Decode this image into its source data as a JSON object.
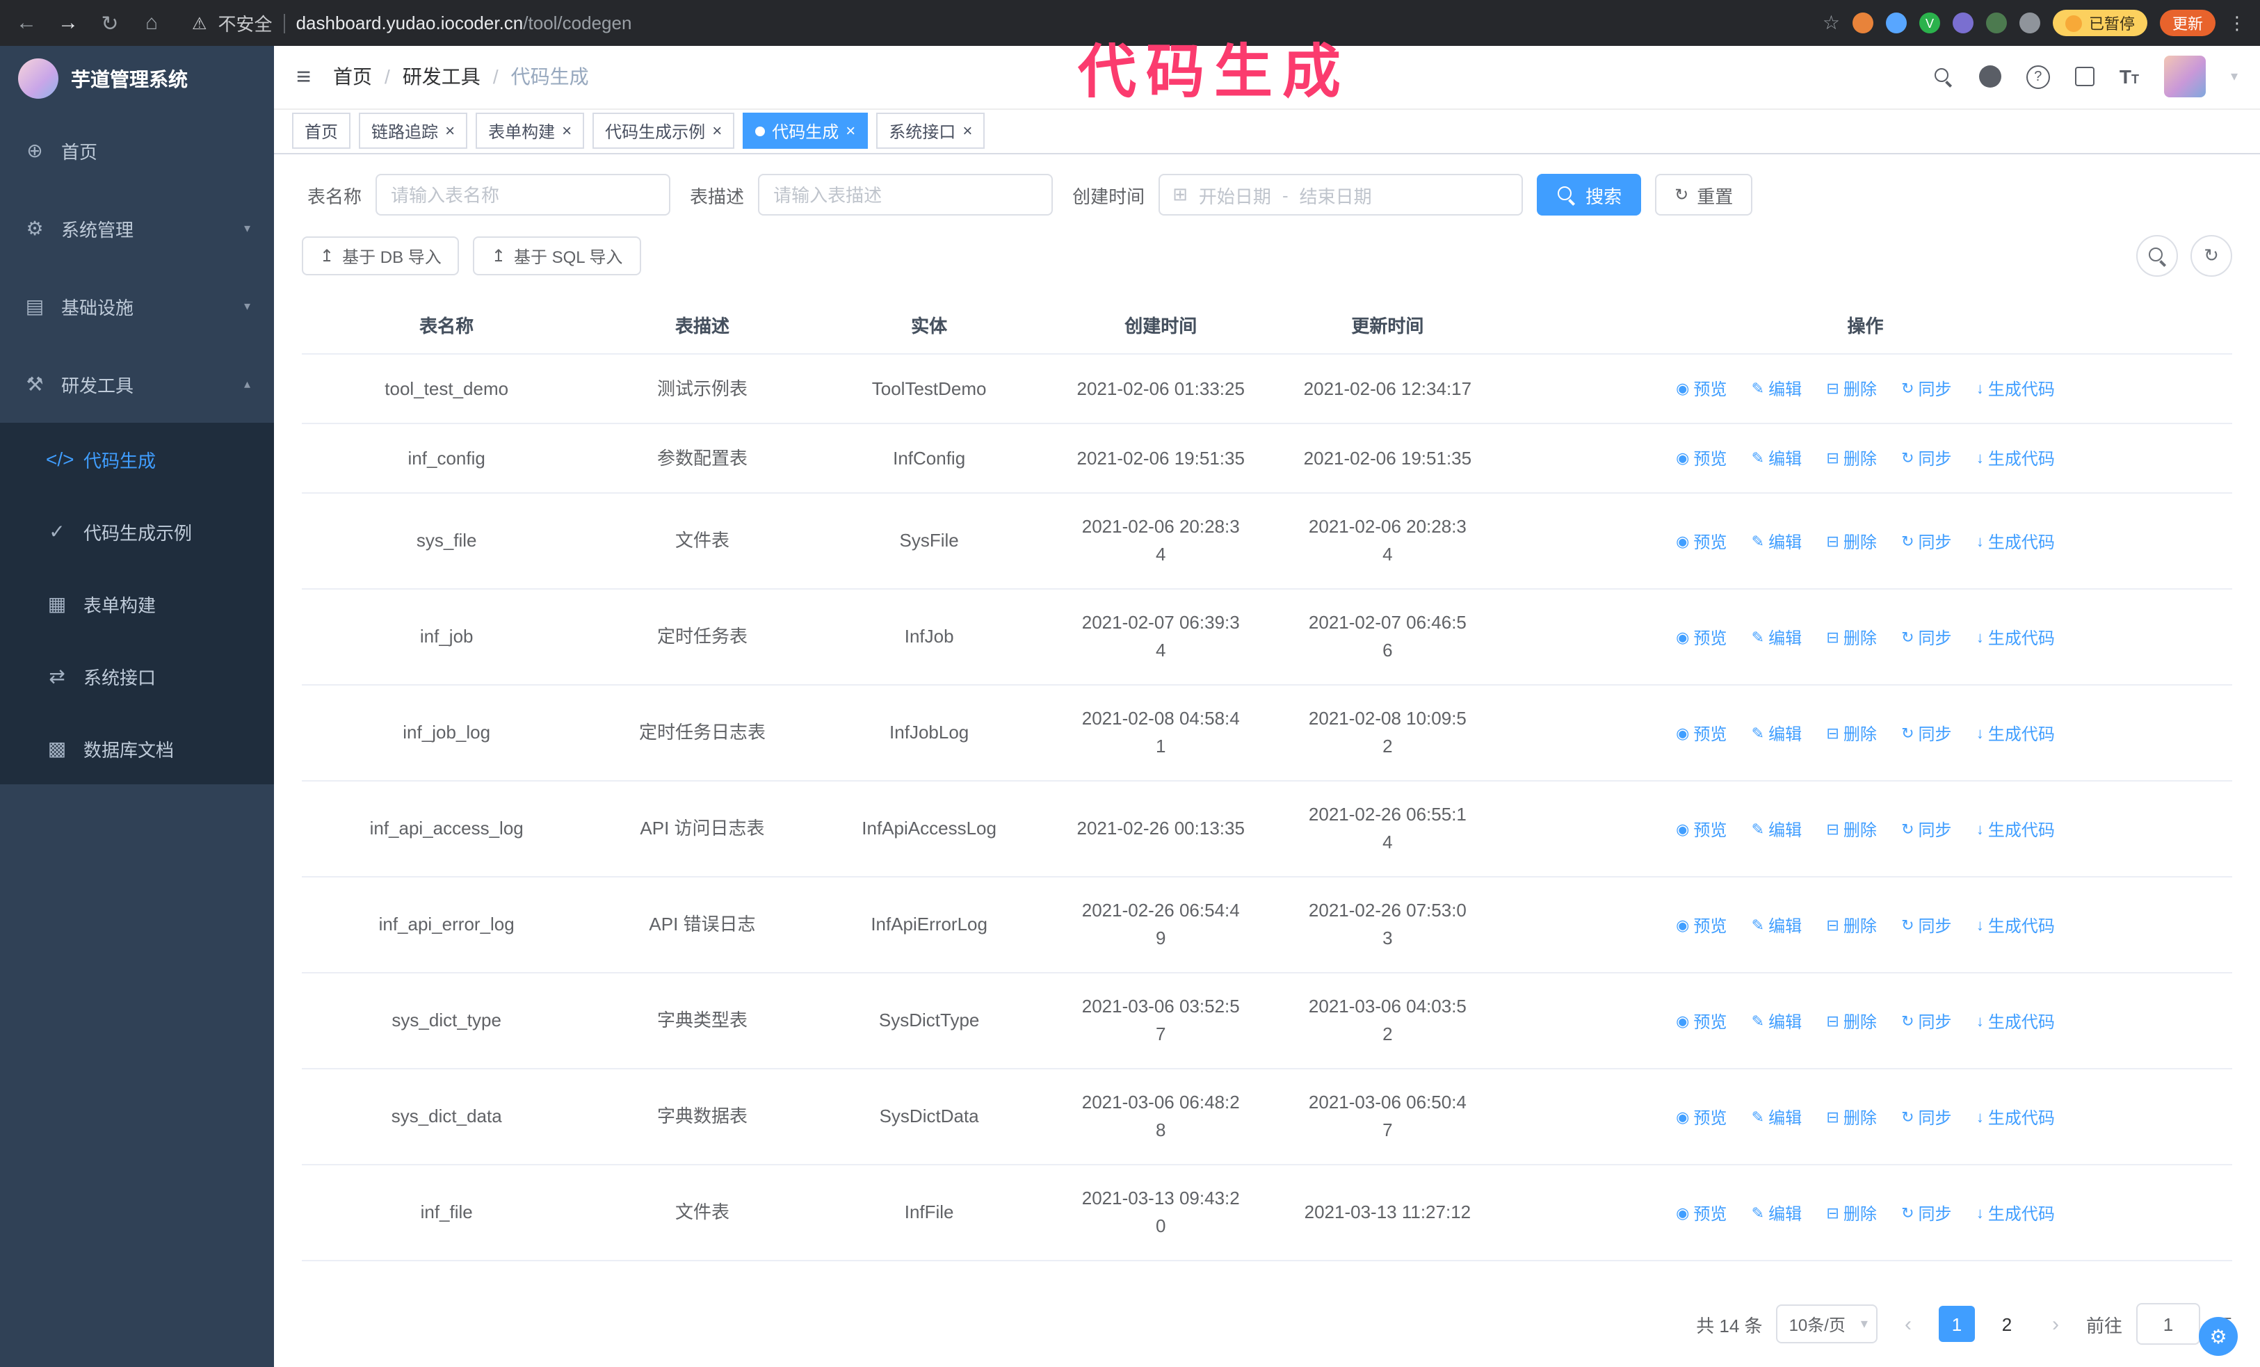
{
  "colors": {
    "accent_blue": "#409eff",
    "sidebar_bg": "#304156",
    "submenu_bg": "#1f2d3d",
    "annotation_pink": "#fb3b6e",
    "chrome_bg": "#26282c",
    "paused_badge_bg": "#fcd05e",
    "update_button_bg": "#e8632c"
  },
  "browser": {
    "security": "不安全",
    "url_domain": "dashboard.yudao.iocoder.cn",
    "url_path": "/tool/codegen",
    "paused_badge": "已暂停",
    "update_button": "更新"
  },
  "annotation": {
    "text": "代码生成"
  },
  "sidebar": {
    "logo_title": "芋道管理系统",
    "items": [
      {
        "label": "首页"
      },
      {
        "label": "系统管理"
      },
      {
        "label": "基础设施"
      },
      {
        "label": "研发工具"
      }
    ],
    "sub_items": [
      {
        "label": "代码生成"
      },
      {
        "label": "代码生成示例"
      },
      {
        "label": "表单构建"
      },
      {
        "label": "系统接口"
      },
      {
        "label": "数据库文档"
      }
    ]
  },
  "header": {
    "breadcrumb": [
      "首页",
      "研发工具",
      "代码生成"
    ]
  },
  "tabs": [
    {
      "label": "首页"
    },
    {
      "label": "链路追踪"
    },
    {
      "label": "表单构建"
    },
    {
      "label": "代码生成示例"
    },
    {
      "label": "代码生成"
    },
    {
      "label": "系统接口"
    }
  ],
  "filters": {
    "name_label": "表名称",
    "name_placeholder": "请输入表名称",
    "desc_label": "表描述",
    "desc_placeholder": "请输入表描述",
    "time_label": "创建时间",
    "start_placeholder": "开始日期",
    "range_separator": "-",
    "end_placeholder": "结束日期",
    "search_label": "搜索",
    "reset_label": "重置"
  },
  "toolbar": {
    "import_db": "基于 DB 导入",
    "import_sql": "基于 SQL 导入"
  },
  "table": {
    "columns": [
      "表名称",
      "表描述",
      "实体",
      "创建时间",
      "更新时间",
      "操作"
    ],
    "ops": {
      "preview": "预览",
      "edit": "编辑",
      "delete": "删除",
      "sync": "同步",
      "generate": "生成代码"
    },
    "rows": [
      {
        "name": "tool_test_demo",
        "desc": "测试示例表",
        "entity": "ToolTestDemo",
        "created": "2021-02-06 01:33:25",
        "updated": "2021-02-06 12:34:17"
      },
      {
        "name": "inf_config",
        "desc": "参数配置表",
        "entity": "InfConfig",
        "created": "2021-02-06 19:51:35",
        "updated": "2021-02-06 19:51:35"
      },
      {
        "name": "sys_file",
        "desc": "文件表",
        "entity": "SysFile",
        "created": "2021-02-06 20:28:3\n4",
        "updated": "2021-02-06 20:28:3\n4"
      },
      {
        "name": "inf_job",
        "desc": "定时任务表",
        "entity": "InfJob",
        "created": "2021-02-07 06:39:3\n4",
        "updated": "2021-02-07 06:46:5\n6"
      },
      {
        "name": "inf_job_log",
        "desc": "定时任务日志表",
        "entity": "InfJobLog",
        "created": "2021-02-08 04:58:4\n1",
        "updated": "2021-02-08 10:09:5\n2"
      },
      {
        "name": "inf_api_access_log",
        "desc": "API 访问日志表",
        "entity": "InfApiAccessLog",
        "created": "2021-02-26 00:13:35",
        "updated": "2021-02-26 06:55:1\n4"
      },
      {
        "name": "inf_api_error_log",
        "desc": "API 错误日志",
        "entity": "InfApiErrorLog",
        "created": "2021-02-26 06:54:4\n9",
        "updated": "2021-02-26 07:53:0\n3"
      },
      {
        "name": "sys_dict_type",
        "desc": "字典类型表",
        "entity": "SysDictType",
        "created": "2021-03-06 03:52:5\n7",
        "updated": "2021-03-06 04:03:5\n2"
      },
      {
        "name": "sys_dict_data",
        "desc": "字典数据表",
        "entity": "SysDictData",
        "created": "2021-03-06 06:48:2\n8",
        "updated": "2021-03-06 06:50:4\n7"
      },
      {
        "name": "inf_file",
        "desc": "文件表",
        "entity": "InfFile",
        "created": "2021-03-13 09:43:2\n0",
        "updated": "2021-03-13 11:27:12"
      }
    ]
  },
  "pagination": {
    "total": "共 14 条",
    "page_size": "10条/页",
    "pages": [
      "1",
      "2"
    ],
    "goto_label": "前往",
    "goto_value": "1",
    "page_unit": "页"
  }
}
